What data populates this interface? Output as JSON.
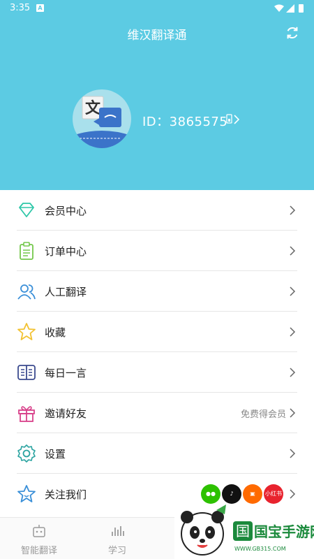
{
  "status_bar": {
    "time": "3:35",
    "notif_letter": "A"
  },
  "header": {
    "title": "维汉翻译通",
    "user_id": "ID：3865575"
  },
  "menu": [
    {
      "label": "会员中心",
      "icon": "diamond-icon"
    },
    {
      "label": "订单中心",
      "icon": "clipboard-icon"
    },
    {
      "label": "人工翻译",
      "icon": "people-icon"
    },
    {
      "label": "收藏",
      "icon": "star-icon"
    },
    {
      "label": "每日一言",
      "icon": "book-icon"
    },
    {
      "label": "邀请好友",
      "icon": "gift-icon",
      "extra": "免费得会员"
    },
    {
      "label": "设置",
      "icon": "gear-icon"
    },
    {
      "label": "关注我们",
      "icon": "star-outline-icon"
    }
  ],
  "social": {
    "xiaohongshu": "小红书"
  },
  "tabs": [
    {
      "label": "智能翻译",
      "icon": "robot-icon"
    },
    {
      "label": "学习",
      "icon": "bars-icon"
    }
  ],
  "watermark": {
    "brand": "国宝手游网",
    "url": "WWW.GB315.COM"
  },
  "colors": {
    "header": "#5ccbe3",
    "accent": "#2ab3d3"
  }
}
